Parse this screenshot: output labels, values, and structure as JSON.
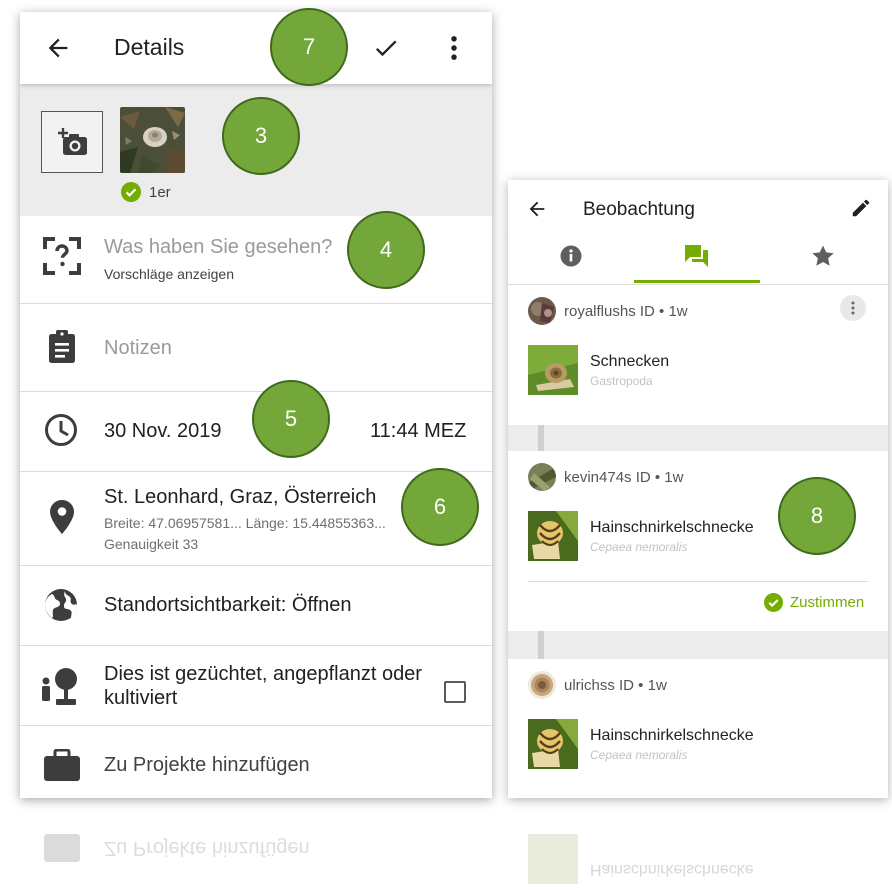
{
  "colors": {
    "brand_green": "#74ac00",
    "callout_green": "#73a73a",
    "strip_gray": "#ececec",
    "text_primary": "#212121",
    "text_secondary": "#6f6f6f"
  },
  "details": {
    "title": "Details",
    "icons": {
      "back": "arrow-left-icon",
      "save": "check-icon",
      "more": "more-vertical-icon",
      "camera": "add-photo-icon"
    },
    "photo_id_count": "1er",
    "species": {
      "placeholder": "Was haben Sie gesehen?",
      "suggestions": "Vorschläge anzeigen"
    },
    "notes_placeholder": "Notizen",
    "date": "30 Nov. 2019",
    "time": "11:44 MEZ",
    "location": {
      "name": "St. Leonhard, Graz, Österreich",
      "coords": "Breite: 47.06957581...  Länge: 15.44855363...",
      "accuracy": "Genauigkeit 33"
    },
    "geoprivacy": "Standortsichtbarkeit: Öffnen",
    "captive": "Dies ist gezüchtet, angepflanzt oder kultiviert",
    "projects": "Zu Projekte hinzufügen"
  },
  "callouts": [
    "7",
    "3",
    "4",
    "5",
    "6",
    "8"
  ],
  "observation": {
    "title": "Beobachtung",
    "tabs": [
      "info-icon",
      "chat-icon",
      "star-icon"
    ],
    "identifications": [
      {
        "user": "royalflushs ID • 1w",
        "common": "Schnecken",
        "scientific": "Gastropoda"
      },
      {
        "user": "kevin474s ID • 1w",
        "common": "Hainschnirkelschnecke",
        "scientific": "Cepaea nemoralis"
      },
      {
        "user": "ulrichss ID • 1w",
        "common": "Hainschnirkelschnecke",
        "scientific": "Cepaea nemoralis"
      }
    ],
    "agree": "Zustimmen"
  }
}
